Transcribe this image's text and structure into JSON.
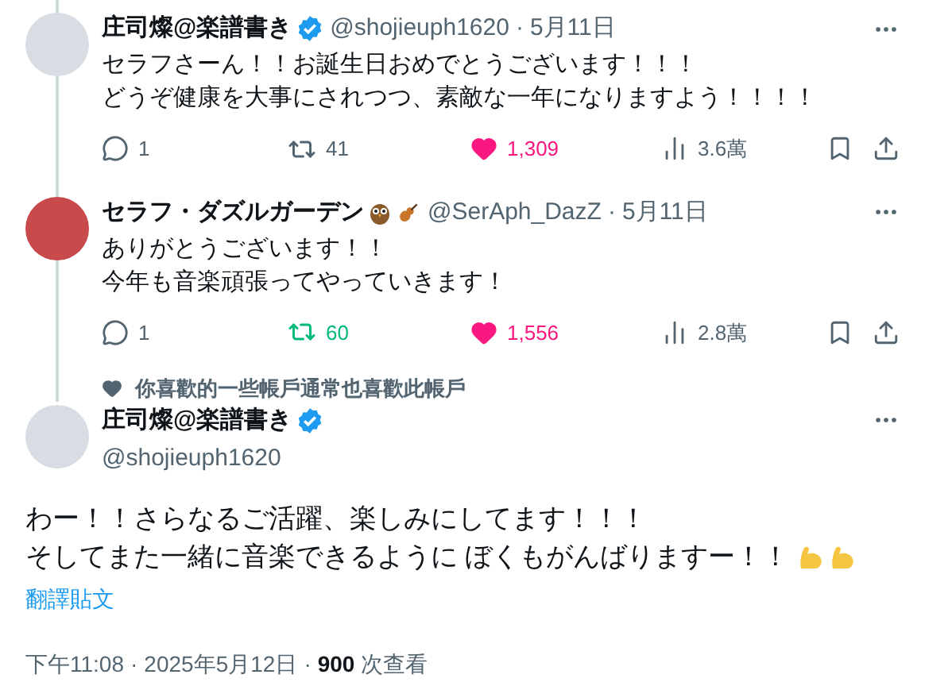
{
  "separator": "·",
  "replies": [
    {
      "name": "庄司燦@楽譜書き",
      "verified": true,
      "handle": "@shojieuph1620",
      "date": "5月11日",
      "lines": [
        "セラフさーん！！お誕生日おめでとうございます！！！",
        "どうぞ健康を大事にされつつ、素敵な一年になりますよう！！！！"
      ],
      "stats": {
        "replies": "1",
        "retweets": "41",
        "retweeted": false,
        "likes": "1,309",
        "liked": true,
        "views": "3.6萬"
      }
    },
    {
      "name": "セラフ・ダズルガーデン",
      "verified": false,
      "handle": "@SerAph_DazZ",
      "date": "5月11日",
      "lines": [
        "ありがとうございます！！",
        "今年も音楽頑張ってやっていきます！"
      ],
      "stats": {
        "replies": "1",
        "retweets": "60",
        "retweeted": true,
        "likes": "1,556",
        "liked": true,
        "views": "2.8萬"
      }
    }
  ],
  "main": {
    "social_context": "你喜歡的一些帳戶通常也喜歡此帳戶",
    "name": "庄司燦@楽譜書き",
    "verified": true,
    "handle": "@shojieuph1620",
    "lines": [
      "わー！！さらなるご活躍、楽しみにしてます！！！",
      "そしてまた一緒に音楽できるように ぼくもがんばりますー！！"
    ],
    "translate": "翻譯貼文",
    "time": "下午11:08",
    "date": "2025年5月12日",
    "views_count": "900",
    "views_label": "次查看"
  }
}
